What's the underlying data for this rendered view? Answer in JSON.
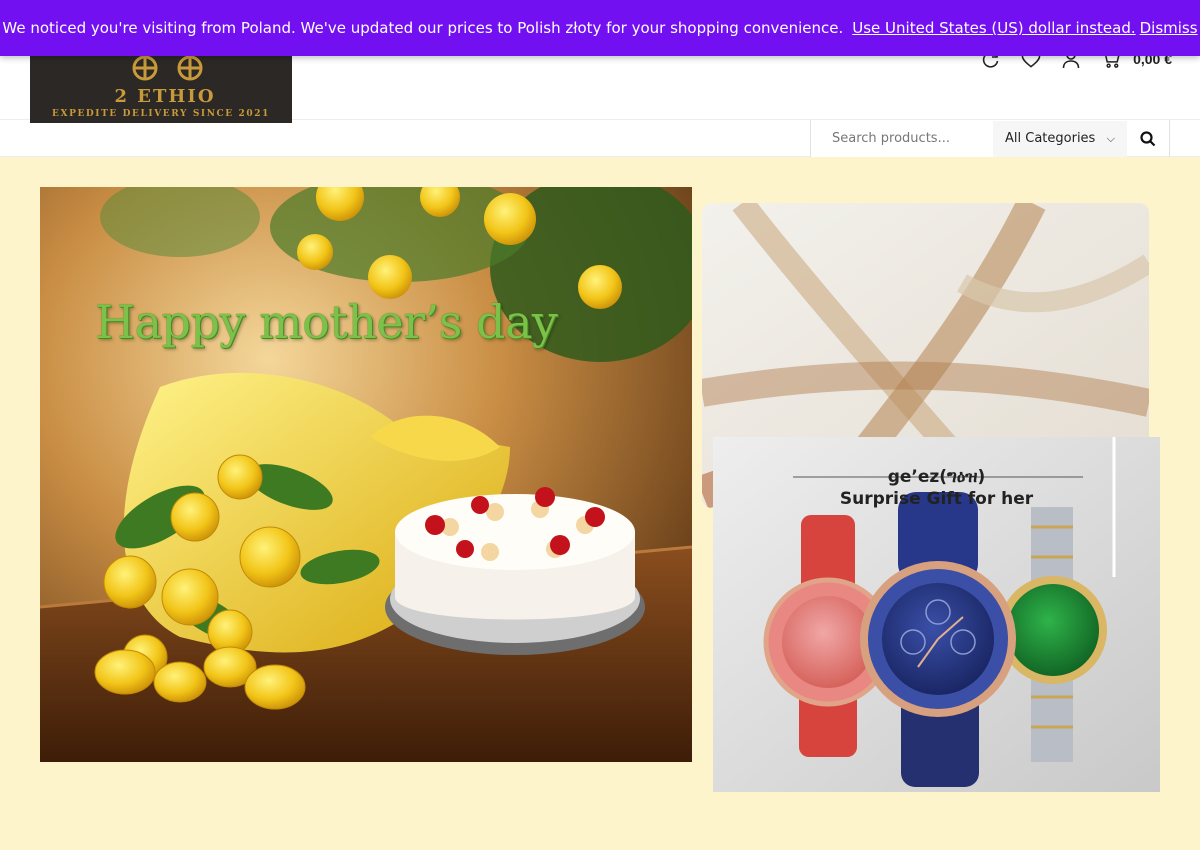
{
  "notice": {
    "message": "We noticed you're visiting from Poland. We've updated our prices to Polish złoty for your shopping convenience.",
    "switch_link": "Use United States (US) dollar instead.",
    "dismiss": "Dismiss"
  },
  "logo": {
    "text": "ET 2 ETHIOPIA",
    "tagline": "EXPEDITE DELIVERY SINCE 2021"
  },
  "header": {
    "cart_total": "0,00 €",
    "icons": [
      "refresh-icon",
      "heart-icon",
      "user-icon",
      "cart-icon"
    ]
  },
  "search": {
    "placeholder": "Search products...",
    "category": "All Categories"
  },
  "banners": {
    "main_headline": "Happy mother’s day",
    "watch_title": "ge’ez(ግዕዝ)",
    "watch_subtitle": "Surprise Gift for her"
  },
  "colors": {
    "notice_bg": "#7310f2",
    "page_bg": "#fdf4cb",
    "headline_green": "#7cc24a"
  }
}
